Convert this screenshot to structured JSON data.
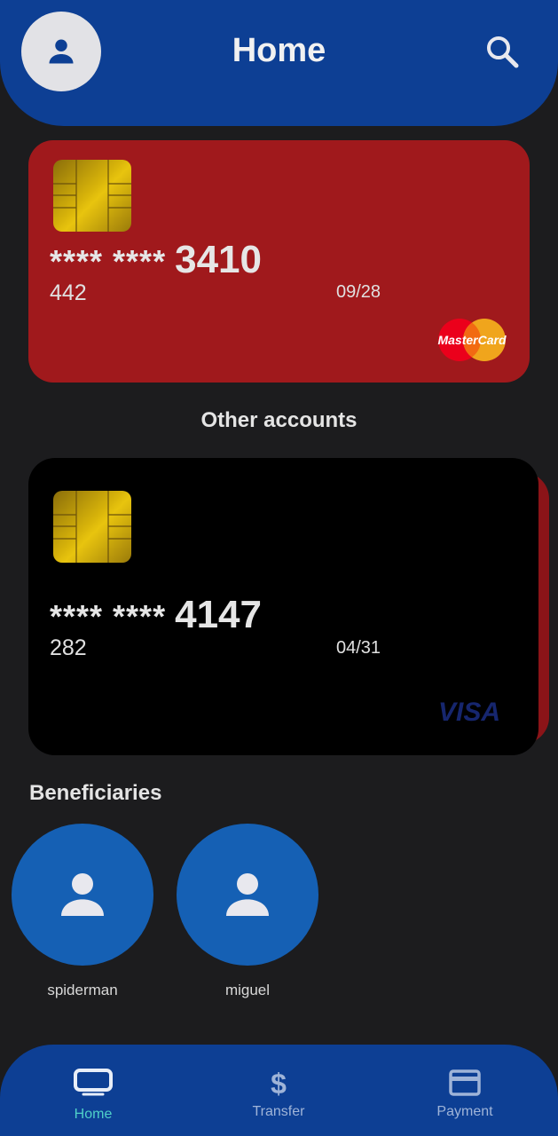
{
  "header": {
    "title": "Home",
    "avatar_icon": "person-icon",
    "search_icon": "search-icon"
  },
  "primary_card": {
    "masked": "**** ****",
    "last4": "3410",
    "cvv": "442",
    "expiry": "09/28",
    "brand": "MasterCard",
    "color": "#a0191c"
  },
  "other_accounts": {
    "title": "Other accounts",
    "cards": [
      {
        "masked": "**** ****",
        "last4": "4147",
        "cvv": "282",
        "expiry": "04/31",
        "brand": "VISA",
        "color": "#000000"
      }
    ]
  },
  "beneficiaries": {
    "title": "Beneficiaries",
    "items": [
      {
        "name": "spiderman",
        "icon": "person-icon"
      },
      {
        "name": "miguel",
        "icon": "person-icon"
      }
    ]
  },
  "bottom_nav": {
    "items": [
      {
        "label": "Home",
        "icon": "card-outline-icon",
        "active": true
      },
      {
        "label": "Transfer",
        "icon": "dollar-icon",
        "active": false
      },
      {
        "label": "Payment",
        "icon": "credit-card-icon",
        "active": false
      }
    ],
    "active_color": "#4fd0c8",
    "inactive_color": "#9fb4d8"
  },
  "colors": {
    "header_bg": "#0d3f94",
    "page_bg": "#1c1c1e",
    "beneficiary_bg": "#1560b4"
  }
}
